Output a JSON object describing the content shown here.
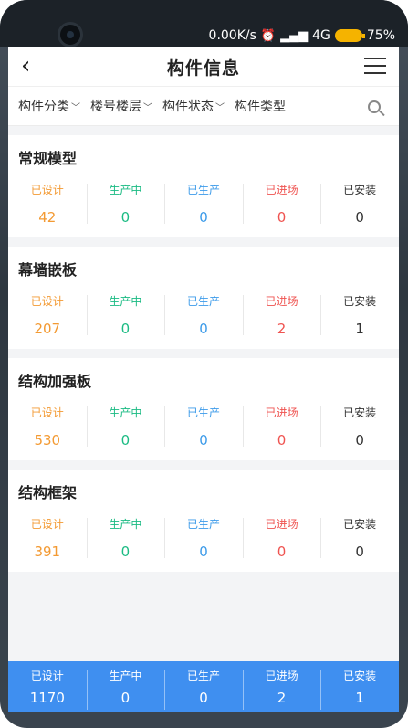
{
  "status_bar": {
    "network_speed": "0.00K/s",
    "signal": "4G",
    "battery": "75%"
  },
  "nav": {
    "title": "构件信息"
  },
  "filters": [
    {
      "label": "构件分类"
    },
    {
      "label": "楼号楼层"
    },
    {
      "label": "构件状态"
    },
    {
      "label": "构件类型"
    }
  ],
  "stat_labels": {
    "designed": "已设计",
    "producing": "生产中",
    "produced": "已生产",
    "entered": "已进场",
    "installed": "已安装"
  },
  "cards": [
    {
      "title": "常规模型",
      "values": [
        "42",
        "0",
        "0",
        "0",
        "0"
      ]
    },
    {
      "title": "幕墙嵌板",
      "values": [
        "207",
        "0",
        "0",
        "2",
        "1"
      ]
    },
    {
      "title": "结构加强板",
      "values": [
        "530",
        "0",
        "0",
        "0",
        "0"
      ]
    },
    {
      "title": "结构框架",
      "values": [
        "391",
        "0",
        "0",
        "0",
        "0"
      ]
    }
  ],
  "summary": {
    "values": [
      "1170",
      "0",
      "0",
      "2",
      "1"
    ]
  },
  "colors": {
    "designed": "#f39a33",
    "producing": "#1bbb83",
    "produced": "#3d9be9",
    "entered": "#ef5350",
    "installed": "#333333",
    "summary_bg": "#3f8ff0"
  }
}
